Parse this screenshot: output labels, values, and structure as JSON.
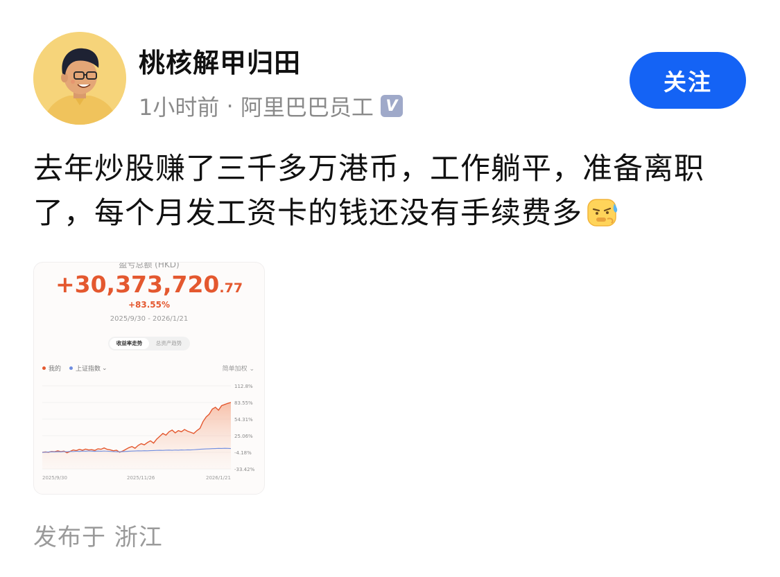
{
  "author": {
    "name": "桃核解甲归田",
    "avatar_icon": "cartoon-man-avatar-icon"
  },
  "meta": {
    "time": "1小时前",
    "separator": " · ",
    "org": "阿里巴巴员工",
    "badge_icon": "verified-v-icon",
    "badge_text": "V"
  },
  "follow_button": {
    "label": "关注",
    "color": "#1463f5"
  },
  "post": {
    "text": "去年炒股赚了三千多万港币，工作躺平，准备离职了，每个月发工资卡的钱还没有手续费多",
    "emoji_icon": "sweating-face-emoji-icon"
  },
  "image_card": {
    "top_text": "盈亏总额 (HKD)",
    "amount_main": "+30,373,720",
    "amount_decimal": ".77",
    "percent": "+83.55%",
    "date_range": "2025/9/30 - 2026/1/21",
    "tabs": [
      {
        "label": "收益率走势",
        "active": true
      },
      {
        "label": "总资产趋势",
        "active": false
      }
    ],
    "legend": [
      {
        "label": "我的",
        "color": "#e4582f"
      },
      {
        "label": "上证指数",
        "suffix": "⌄",
        "color": "#6f8de0"
      }
    ],
    "weighting_label": "简单加权 ⌄",
    "chart_data": {
      "type": "line",
      "x_ticks": [
        "2025/9/30",
        "2025/11/26",
        "2026/1/21"
      ],
      "y_ticks": [
        "112.8%",
        "83.55%",
        "54.31%",
        "25.06%",
        "-4.18%",
        "-33.42%"
      ],
      "ylim": [
        -33.42,
        112.8
      ],
      "series": [
        {
          "name": "我的",
          "color": "#e4582f",
          "values": [
            -4.2,
            -3.5,
            -4,
            -2.8,
            -3.2,
            -1.5,
            -3,
            -2,
            -5,
            -2.5,
            0,
            -1.2,
            1,
            -0.5,
            1.5,
            0,
            0.5,
            -0.8,
            2,
            1.2,
            3.5,
            1,
            0.2,
            -1.5,
            -0.5,
            -4,
            -2,
            1,
            4,
            6,
            3,
            8,
            11,
            9,
            13,
            16,
            12,
            19,
            24,
            29,
            26,
            32,
            35,
            30,
            34,
            32,
            36,
            33,
            31,
            29,
            34,
            38,
            50,
            58,
            63,
            72,
            75,
            70,
            78,
            80,
            82,
            83.55
          ]
        },
        {
          "name": "上证指数",
          "color": "#6f8de0",
          "values": [
            -4.2,
            -4,
            -3.6,
            -3.2,
            -3.5,
            -3,
            -3.3,
            -2.8,
            -3.1,
            -2.5,
            -2.8,
            -2.2,
            -2.6,
            -2,
            -2.3,
            -1.8,
            -2.1,
            -2.4,
            -2,
            -2.3,
            -1.9,
            -2.2,
            -2.5,
            -2.8,
            -3,
            -3.2,
            -2.9,
            -2.6,
            -2.3,
            -2,
            -1.8,
            -1.5,
            -1.6,
            -1.3,
            -1.5,
            -1.2,
            -1,
            -0.8,
            -0.6,
            -0.8,
            -0.5,
            -0.3,
            -0.6,
            -0.2,
            -0.4,
            0,
            -0.2,
            0.2,
            0,
            0.4,
            0.8,
            1.2,
            1.5,
            1.8,
            2,
            2.3,
            2.5,
            2.8,
            2.6,
            2.9,
            2.7,
            2.5
          ]
        }
      ]
    }
  },
  "location": {
    "label": "发布于",
    "place": "浙江"
  }
}
